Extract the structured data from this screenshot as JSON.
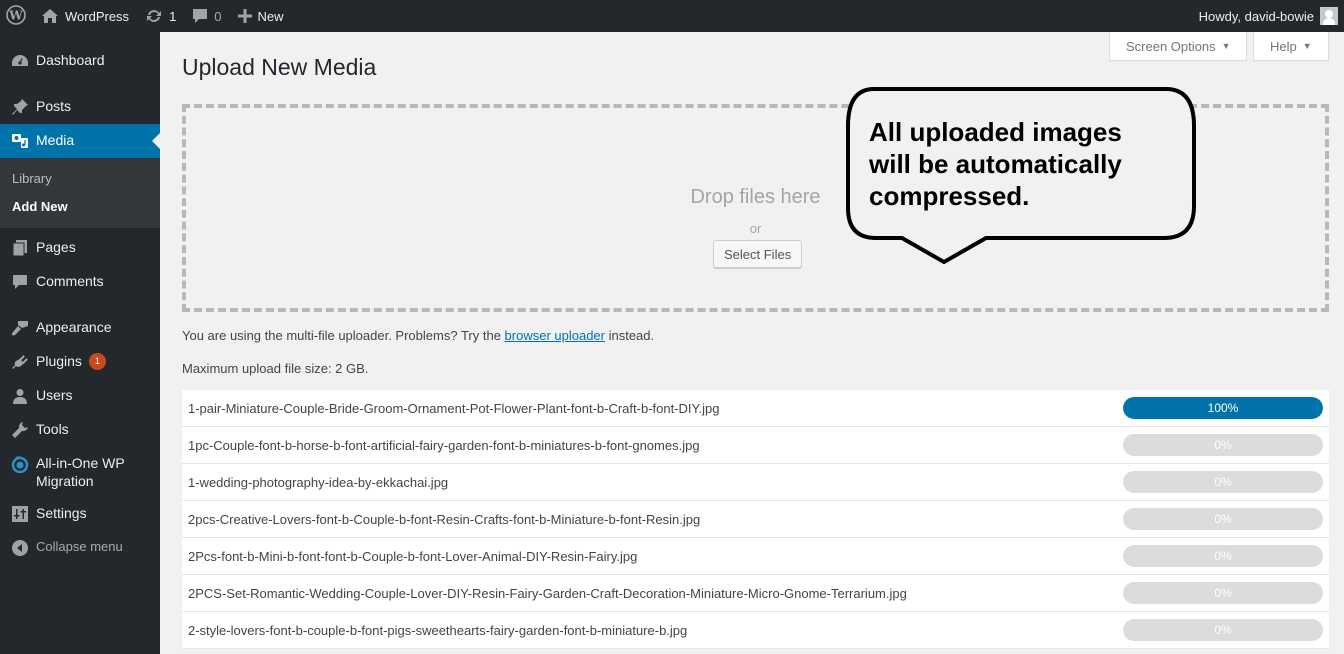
{
  "adminbar": {
    "wp_logo": "wordpress-logo-icon",
    "site_name": "WordPress",
    "updates_count": "1",
    "comments_count": "0",
    "new_label": "New",
    "howdy": "Howdy, david-bowie"
  },
  "sidebar": {
    "items": [
      {
        "label": "Dashboard",
        "icon": "dashboard-icon"
      },
      {
        "label": "Posts",
        "icon": "pin-icon"
      },
      {
        "label": "Media",
        "icon": "media-icon",
        "current": true
      },
      {
        "label": "Pages",
        "icon": "pages-icon"
      },
      {
        "label": "Comments",
        "icon": "comment-icon"
      },
      {
        "label": "Appearance",
        "icon": "paintbrush-icon"
      },
      {
        "label": "Plugins",
        "icon": "plugin-icon",
        "badge": "1"
      },
      {
        "label": "Users",
        "icon": "user-icon"
      },
      {
        "label": "Tools",
        "icon": "wrench-icon"
      },
      {
        "label": "All-in-One WP Migration",
        "icon": "migration-icon"
      },
      {
        "label": "Settings",
        "icon": "settings-icon"
      }
    ],
    "media_submenu": [
      "Library",
      "Add New"
    ],
    "collapse_label": "Collapse menu"
  },
  "header": {
    "screen_options": "Screen Options",
    "help": "Help",
    "title": "Upload New Media"
  },
  "uploader": {
    "drop_title": "Drop files here",
    "or": "or",
    "select_files": "Select Files",
    "info_prefix": "You are using the multi-file uploader. Problems? Try the ",
    "info_link": "browser uploader",
    "info_suffix": " instead.",
    "max_size": "Maximum upload file size: 2 GB."
  },
  "callout": {
    "text_line1": "All uploaded images",
    "text_line2": "will be automatically",
    "text_line3": "compressed."
  },
  "files": [
    {
      "name": "1-pair-Miniature-Couple-Bride-Groom-Ornament-Pot-Flower-Plant-font-b-Craft-b-font-DIY.jpg",
      "progress": 100,
      "label": "100%"
    },
    {
      "name": "1pc-Couple-font-b-horse-b-font-artificial-fairy-garden-font-b-miniatures-b-font-gnomes.jpg",
      "progress": 0,
      "label": "0%"
    },
    {
      "name": "1-wedding-photography-idea-by-ekkachai.jpg",
      "progress": 0,
      "label": "0%"
    },
    {
      "name": "2pcs-Creative-Lovers-font-b-Couple-b-font-Resin-Crafts-font-b-Miniature-b-font-Resin.jpg",
      "progress": 0,
      "label": "0%"
    },
    {
      "name": "2Pcs-font-b-Mini-b-font-font-b-Couple-b-font-Lover-Animal-DIY-Resin-Fairy.jpg",
      "progress": 0,
      "label": "0%"
    },
    {
      "name": "2PCS-Set-Romantic-Wedding-Couple-Lover-DIY-Resin-Fairy-Garden-Craft-Decoration-Miniature-Micro-Gnome-Terrarium.jpg",
      "progress": 0,
      "label": "0%"
    },
    {
      "name": "2-style-lovers-font-b-couple-b-font-pigs-sweethearts-fairy-garden-font-b-miniature-b.jpg",
      "progress": 0,
      "label": "0%"
    }
  ],
  "colors": {
    "accent": "#0073aa",
    "adminbar_bg": "#23282d",
    "badge": "#ca4a1f",
    "progress_track": "#dcdcdc"
  }
}
